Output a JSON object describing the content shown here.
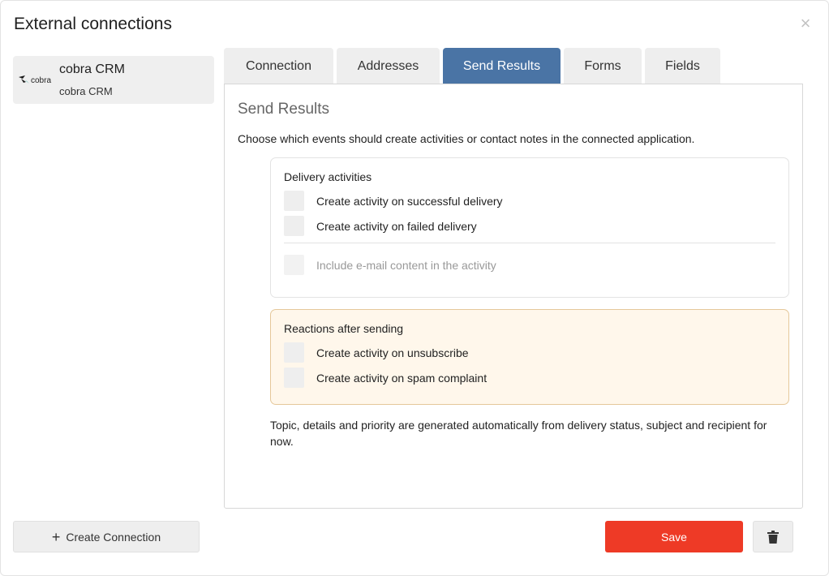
{
  "dialog": {
    "title": "External connections",
    "close_glyph": "×"
  },
  "sidebar": {
    "items": [
      {
        "name": "cobra CRM",
        "sub": "cobra CRM",
        "logo_text": "cobra",
        "logo_icon": "cobra-logo-icon"
      }
    ],
    "create_button": {
      "plus": "+",
      "label": "Create Connection"
    }
  },
  "tabs": [
    {
      "label": "Connection"
    },
    {
      "label": "Addresses"
    },
    {
      "label": "Send Results",
      "active": true
    },
    {
      "label": "Forms"
    },
    {
      "label": "Fields"
    }
  ],
  "panel": {
    "title": "Send Results",
    "description": "Choose which events should create activities or contact notes in the connected application.",
    "delivery": {
      "heading": "Delivery activities",
      "options": [
        {
          "label": "Create activity on successful delivery",
          "checked": false
        },
        {
          "label": "Create activity on failed delivery",
          "checked": false
        },
        {
          "label": "Include e-mail content in the activity",
          "checked": false,
          "disabled": true
        }
      ]
    },
    "reactions": {
      "heading": "Reactions after sending",
      "options": [
        {
          "label": "Create activity on unsubscribe",
          "checked": false
        },
        {
          "label": "Create activity on spam complaint",
          "checked": false
        }
      ]
    },
    "footnote": "Topic, details and priority are generated automatically from delivery status, subject and recipient for now."
  },
  "footer": {
    "save_label": "Save",
    "delete_icon": "trash-icon"
  },
  "colors": {
    "accent_tab": "#4a74a5",
    "save": "#ee3a26",
    "reactions_bg": "#fff7eb",
    "reactions_border": "#e5c89a"
  }
}
